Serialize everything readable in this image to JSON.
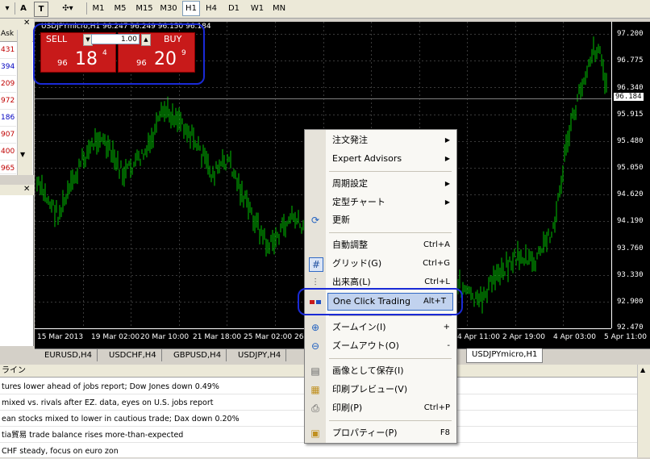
{
  "toolbar": {
    "tools": [
      "A",
      "T"
    ],
    "timeframes": [
      "M1",
      "M5",
      "M15",
      "M30",
      "H1",
      "H4",
      "D1",
      "W1",
      "MN"
    ],
    "active_timeframe": "H1"
  },
  "market_watch": {
    "header": "Ask",
    "values": [
      "431",
      "394",
      "209",
      "972",
      "186",
      "907",
      "400",
      "965"
    ]
  },
  "chart": {
    "title": "USDJPYmicro,H1  96.247 96.249 96.150 96.184",
    "current_price": "96.184",
    "price_labels": [
      "97.200",
      "96.775",
      "96.340",
      "95.915",
      "95.480",
      "95.050",
      "94.620",
      "94.190",
      "93.760",
      "93.330",
      "92.900",
      "92.470"
    ],
    "date_labels": [
      "15 Mar 2013",
      "19 Mar 02:00",
      "20 Mar 10:00",
      "21 Mar 18:00",
      "25 Mar 02:00",
      "26",
      "4 Apr 11:00",
      "2 Apr 19:00",
      "4 Apr 03:00",
      "5 Apr 11:00"
    ],
    "colors": {
      "background": "#000000",
      "candles": "#00c000",
      "grid": "#3a3a3a",
      "text": "#ffffff"
    }
  },
  "one_click": {
    "sell_label": "SELL",
    "buy_label": "BUY",
    "lot": "1.00",
    "sell_prefix": "96",
    "sell_big": "18",
    "sell_sup": "4",
    "buy_prefix": "96",
    "buy_big": "20",
    "buy_sup": "9",
    "color": "#c81a1a"
  },
  "tabs": [
    "EURUSD,H4",
    "USDCHF,H4",
    "GBPUSD,H4",
    "USDJPY,H4",
    "USDJPYmicro,H1"
  ],
  "active_tab": "USDJPYmicro,H1",
  "news": {
    "header": "ライン",
    "rows": [
      "tures lower ahead of jobs report; Dow Jones down 0.49%",
      "mixed vs. rivals after EZ. data, eyes on U.S. jobs report",
      "ean stocks mixed to lower in cautious trade; Dax down 0.20%",
      "tia貿易 trade balance rises more-than-expected",
      "CHF steady, focus on euro zon"
    ]
  },
  "context_menu": {
    "items": [
      {
        "label": "注文発注",
        "shortcut": "",
        "submenu": true,
        "icon": ""
      },
      {
        "label": "Expert Advisors",
        "shortcut": "",
        "submenu": true,
        "icon": ""
      },
      {
        "label": "周期設定",
        "shortcut": "",
        "submenu": true,
        "icon": ""
      },
      {
        "label": "定型チャート",
        "shortcut": "",
        "submenu": true,
        "icon": ""
      },
      {
        "label": "更新",
        "shortcut": "",
        "submenu": false,
        "icon": "refresh-icon"
      },
      {
        "label": "自動調整",
        "shortcut": "Ctrl+A",
        "submenu": false,
        "icon": ""
      },
      {
        "label": "グリッド(G)",
        "shortcut": "Ctrl+G",
        "submenu": false,
        "icon": "grid-icon"
      },
      {
        "label": "出来高(L)",
        "shortcut": "Ctrl+L",
        "submenu": false,
        "icon": "volume-icon"
      },
      {
        "label": "One Click Trading",
        "shortcut": "Alt+T",
        "submenu": false,
        "icon": "one-click-icon"
      },
      {
        "label": "ズームイン(I)",
        "shortcut": "+",
        "submenu": false,
        "icon": "zoom-in-icon"
      },
      {
        "label": "ズームアウト(O)",
        "shortcut": "-",
        "submenu": false,
        "icon": "zoom-out-icon"
      },
      {
        "label": "画像として保存(I)",
        "shortcut": "",
        "submenu": false,
        "icon": "save-image-icon"
      },
      {
        "label": "印刷プレビュー(V)",
        "shortcut": "",
        "submenu": false,
        "icon": "print-preview-icon"
      },
      {
        "label": "印刷(P)",
        "shortcut": "Ctrl+P",
        "submenu": false,
        "icon": "print-icon"
      },
      {
        "label": "プロパティー(P)",
        "shortcut": "F8",
        "submenu": false,
        "icon": "properties-icon"
      }
    ]
  }
}
